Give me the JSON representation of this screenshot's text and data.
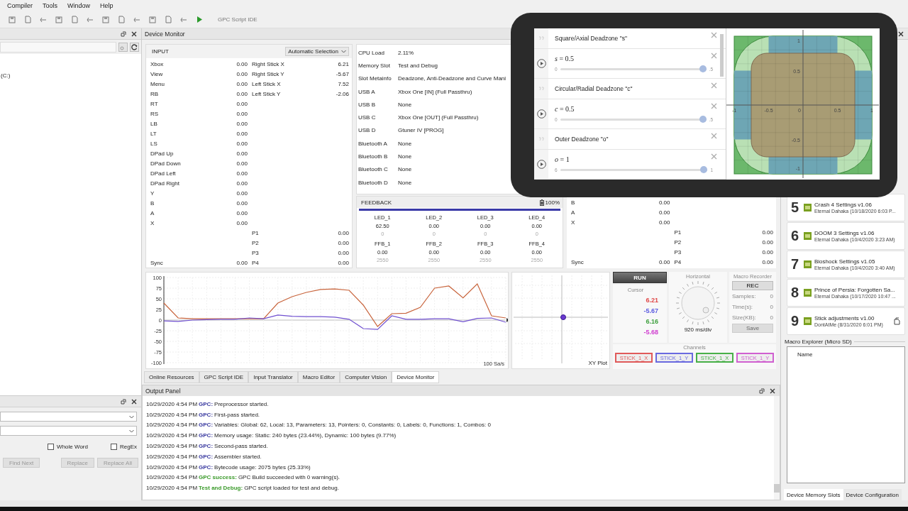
{
  "menu": [
    "Compiler",
    "Tools",
    "Window",
    "Help"
  ],
  "toolbar": {
    "label": "GPC Script IDE"
  },
  "explorer": {
    "item": "(C:)"
  },
  "find_panel": {
    "options": [
      {
        "label": "Whole Word",
        "checked": false
      },
      {
        "label": "RegEx",
        "checked": false
      }
    ],
    "buttons": [
      {
        "label": "Find Next",
        "disabled": true
      },
      {
        "label": "Replace",
        "disabled": true
      },
      {
        "label": "Replace All",
        "disabled": true
      }
    ]
  },
  "device_monitor": {
    "title": "Device Monitor",
    "input": {
      "title": "INPUT",
      "selector": "Automatic Selection",
      "buttons": [
        {
          "label": "Xbox",
          "value": "0.00"
        },
        {
          "label": "View",
          "value": "0.00"
        },
        {
          "label": "Menu",
          "value": "0.00"
        },
        {
          "label": "RB",
          "value": "0.00"
        },
        {
          "label": "RT",
          "value": "0.00"
        },
        {
          "label": "RS",
          "value": "0.00"
        },
        {
          "label": "LB",
          "value": "0.00"
        },
        {
          "label": "LT",
          "value": "0.00"
        },
        {
          "label": "LS",
          "value": "0.00"
        },
        {
          "label": "DPad Up",
          "value": "0.00"
        },
        {
          "label": "DPad Down",
          "value": "0.00"
        },
        {
          "label": "DPad Left",
          "value": "0.00"
        },
        {
          "label": "DPad Right",
          "value": "0.00"
        },
        {
          "label": "Y",
          "value": "0.00"
        },
        {
          "label": "B",
          "value": "0.00"
        },
        {
          "label": "A",
          "value": "0.00"
        },
        {
          "label": "X",
          "value": "0.00"
        }
      ],
      "sticks": [
        {
          "label": "Right Stick X",
          "value": "6.21"
        },
        {
          "label": "Right Stick Y",
          "value": "-5.67"
        },
        {
          "label": "Left Stick X",
          "value": "7.52"
        },
        {
          "label": "Left Stick Y",
          "value": "-2.06"
        }
      ],
      "paddles": [
        {
          "label": "P1",
          "value": "0.00"
        },
        {
          "label": "P2",
          "value": "0.00"
        },
        {
          "label": "P3",
          "value": "0.00"
        },
        {
          "label": "P4",
          "value": "0.00"
        }
      ],
      "sync": {
        "label": "Sync",
        "value": "0.00"
      }
    },
    "info": [
      {
        "label": "CPU Load",
        "value": "2.11%"
      },
      {
        "label": "Memory Slot",
        "value": "Test and Debug"
      },
      {
        "label": "Slot Metainfo",
        "value": "Deadzone, Anti-Deadzone and Curve Mani"
      },
      {
        "label": "USB A",
        "value": "Xbox One [IN] (Full Passthru)"
      },
      {
        "label": "USB B",
        "value": "None"
      },
      {
        "label": "USB C",
        "value": "Xbox One [OUT] (Full Passthru)"
      },
      {
        "label": "USB D",
        "value": "Gtuner IV [PROG]"
      },
      {
        "label": "Bluetooth A",
        "value": "None"
      },
      {
        "label": "Bluetooth B",
        "value": "None"
      },
      {
        "label": "Bluetooth C",
        "value": "None"
      },
      {
        "label": "Bluetooth D",
        "value": "None"
      }
    ],
    "feedback": {
      "title": "FEEDBACK",
      "battery": "100%",
      "channels": [
        {
          "name": "LED_1",
          "value": "62.50",
          "raw": "0"
        },
        {
          "name": "LED_2",
          "value": "0.00",
          "raw": "0"
        },
        {
          "name": "LED_3",
          "value": "0.00",
          "raw": "0"
        },
        {
          "name": "LED_4",
          "value": "0.00",
          "raw": "0"
        },
        {
          "name": "FFB_1",
          "value": "0.00",
          "raw": "2550"
        },
        {
          "name": "FFB_2",
          "value": "0.00",
          "raw": "2550"
        },
        {
          "name": "FFB_3",
          "value": "0.00",
          "raw": "2550"
        },
        {
          "name": "FFB_4",
          "value": "0.00",
          "raw": "2550"
        }
      ]
    },
    "output": {
      "buttons": [
        {
          "label": "B",
          "value": "0.00"
        },
        {
          "label": "A",
          "value": "0.00"
        },
        {
          "label": "X",
          "value": "0.00"
        }
      ],
      "paddles": [
        {
          "label": "P1",
          "value": "0.00"
        },
        {
          "label": "P2",
          "value": "0.00"
        },
        {
          "label": "P3",
          "value": "0.00"
        },
        {
          "label": "P4",
          "value": "0.00"
        }
      ],
      "sync": {
        "label": "Sync",
        "value": "0.00"
      }
    },
    "scope": {
      "rate": "100 Sa/s",
      "chart_data": {
        "type": "line",
        "categories": [
          null,
          null,
          null,
          null,
          null,
          null,
          null,
          null,
          null,
          null,
          null,
          null,
          null,
          null,
          null,
          null,
          null,
          null,
          null,
          null,
          null,
          null,
          null,
          null,
          null
        ],
        "ylim": [
          -100,
          100
        ],
        "yticks": [
          100,
          75,
          50,
          25,
          0,
          -25,
          -50,
          -75,
          -100
        ],
        "grid": true,
        "series": [
          {
            "color": "#c8643c",
            "values": [
              40,
              5,
              3,
              3,
              3,
              3,
              3,
              3,
              40,
              55,
              65,
              72,
              73,
              70,
              35,
              -15,
              15,
              16,
              30,
              75,
              80,
              52,
              85,
              10,
              5
            ]
          },
          {
            "color": "#7050d0",
            "values": [
              -2,
              -3,
              0,
              1,
              2,
              2,
              5,
              3,
              12,
              9,
              8,
              8,
              7,
              2,
              -20,
              -22,
              10,
              2,
              2,
              3,
              3,
              -4,
              4,
              5,
              -5
            ]
          }
        ]
      }
    },
    "xy_plot": {
      "label": "XY Plot"
    },
    "controls": {
      "run": "RUN",
      "cursor": {
        "title": "Cursor",
        "values": [
          {
            "value": "6.21",
            "color": "#e04848"
          },
          {
            "value": "-5.67",
            "color": "#5a5ae0"
          },
          {
            "value": "6.16",
            "color": "#3fa03f"
          },
          {
            "value": "-5.68",
            "color": "#d040d0"
          }
        ]
      },
      "horizontal": {
        "title": "Horizontal",
        "reading": "920 ms/div"
      },
      "recorder": {
        "title": "Macro Recorder",
        "record": "REC",
        "stats": [
          {
            "label": "Samples:",
            "value": "0"
          },
          {
            "label": "Time(s):",
            "value": "0"
          },
          {
            "label": "Size(KB):",
            "value": "0"
          }
        ],
        "save": {
          "label": "Save",
          "disabled": true
        }
      },
      "channels": {
        "title": "Channels",
        "items": [
          {
            "label": "STICK_1_X",
            "color": "#e05a5a"
          },
          {
            "label": "STICK_1_Y",
            "color": "#6a6ae0"
          },
          {
            "label": "STICK_1_X",
            "color": "#48b048"
          },
          {
            "label": "STICK_1_Y",
            "color": "#d060d0"
          }
        ]
      }
    },
    "tabs": [
      {
        "label": "Online Resources",
        "selected": false
      },
      {
        "label": "GPC Script IDE",
        "selected": false
      },
      {
        "label": "Input Translator",
        "selected": false
      },
      {
        "label": "Macro Editor",
        "selected": false
      },
      {
        "label": "Computer Vision",
        "selected": false
      },
      {
        "label": "Device Monitor",
        "selected": true
      }
    ]
  },
  "output_panel": {
    "title": "Output Panel",
    "lines": [
      {
        "time": "10/29/2020 4:54 PM",
        "kind": "info",
        "source": "GPC:",
        "message": "Preprocessor started."
      },
      {
        "time": "10/29/2020 4:54 PM",
        "kind": "info",
        "source": "GPC:",
        "message": "First-pass started."
      },
      {
        "time": "10/29/2020 4:54 PM",
        "kind": "info",
        "source": "GPC:",
        "message": "Variables: Global: 62, Local: 13, Parameters: 13, Pointers: 0, Constants: 0, Labels: 0, Functions: 1, Combos: 0"
      },
      {
        "time": "10/29/2020 4:54 PM",
        "kind": "info",
        "source": "GPC:",
        "message": "Memory usage: Static: 240 bytes (23.44%), Dynamic: 100 bytes (9.77%)"
      },
      {
        "time": "10/29/2020 4:54 PM",
        "kind": "info",
        "source": "GPC:",
        "message": "Second-pass started."
      },
      {
        "time": "10/29/2020 4:54 PM",
        "kind": "info",
        "source": "GPC:",
        "message": "Assembler started."
      },
      {
        "time": "10/29/2020 4:54 PM",
        "kind": "info",
        "source": "GPC:",
        "message": "Bytecode usage: 2075 bytes (25.33%)"
      },
      {
        "time": "10/29/2020 4:54 PM",
        "kind": "success",
        "source": "GPC success:",
        "message": "GPC Build succeeded with 0 warning(s)."
      },
      {
        "time": "10/29/2020 4:54 PM",
        "kind": "success",
        "source": "Test and Debug:",
        "message": "GPC script loaded for test and debug."
      }
    ]
  },
  "memory_slots": {
    "slots": [
      {
        "number": "5",
        "title": "Crash 4 Settings v1.06",
        "subtitle": "Eternal Dahaka (10/18/2020 6:03 P...",
        "badge": false
      },
      {
        "number": "6",
        "title": "DOOM 3 Settings v1.06",
        "subtitle": "Eternal Dahaka (10/4/2020 3:23 AM)",
        "badge": false
      },
      {
        "number": "7",
        "title": "Bioshock Settings v1.05",
        "subtitle": "Eternal Dahaka (10/4/2020 3:40 AM)",
        "badge": false
      },
      {
        "number": "8",
        "title": "Prince of Persia: Forgotten Sa...",
        "subtitle": "Eternal Dahaka (10/17/2020 10:47 ...",
        "badge": false
      },
      {
        "number": "9",
        "title": "Stick adjustments v1.00",
        "subtitle": "DontAtMe (8/31/2020 6:01 PM)",
        "badge": true
      }
    ],
    "macro_explorer": {
      "title": "Macro Explorer (Micro SD)",
      "column": "Name"
    },
    "tabs": [
      {
        "label": "Device Memory Slots",
        "selected": true
      },
      {
        "label": "Device Configuration",
        "selected": false
      }
    ]
  },
  "overlay": {
    "expressions": [
      {
        "kind": "note",
        "text": "Square/Axial Deadzone \"s\""
      },
      {
        "kind": "slider",
        "equation": "*s* = 0.5",
        "min": "0",
        "max": ".5",
        "level": 1
      },
      {
        "kind": "note",
        "text": "Circular/Radial Deadzone \"c\""
      },
      {
        "kind": "slider",
        "equation": "*c* = 0.5",
        "min": "0",
        "max": ".5",
        "level": 1
      },
      {
        "kind": "note",
        "text": "Outer Deadzone \"o\""
      },
      {
        "kind": "slider",
        "equation": "*o* = 1",
        "min": "6",
        "max": "1",
        "level": 1
      }
    ],
    "graph": {
      "x_labels": [
        "-1",
        "-0.5",
        "0",
        "0.5",
        "1"
      ],
      "y_labels": [
        "1",
        "0.5",
        "-0.5",
        "-1"
      ]
    }
  }
}
